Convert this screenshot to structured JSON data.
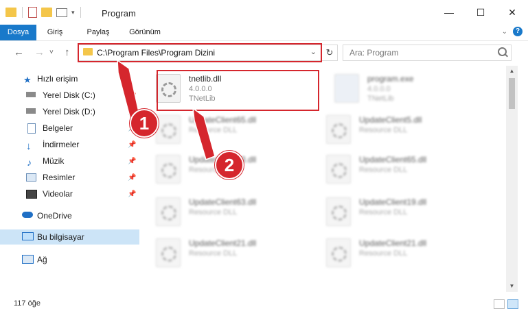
{
  "window": {
    "title": "Program",
    "controls": [
      "—",
      "☐",
      "✕"
    ]
  },
  "ribbon": {
    "tabs": [
      "Dosya",
      "Giriş",
      "Paylaş",
      "Görünüm"
    ],
    "help": "?"
  },
  "nav": {
    "address": "C:\\Program Files\\Program Dizini",
    "search_placeholder": "Ara: Program"
  },
  "sidebar": {
    "items": [
      {
        "label": "Hızlı erişim",
        "icon": "star-icon"
      },
      {
        "label": "Yerel Disk (C:)",
        "icon": "drive-icon"
      },
      {
        "label": "Yerel Disk (D:)",
        "icon": "drive-icon"
      },
      {
        "label": "Belgeler",
        "icon": "documents-icon"
      },
      {
        "label": "İndirmeler",
        "icon": "download-icon"
      },
      {
        "label": "Müzik",
        "icon": "music-icon"
      },
      {
        "label": "Resimler",
        "icon": "pictures-icon"
      },
      {
        "label": "Videolar",
        "icon": "video-icon"
      },
      {
        "label": "OneDrive",
        "icon": "cloud-icon"
      },
      {
        "label": "Bu bilgisayar",
        "icon": "computer-icon"
      },
      {
        "label": "Ağ",
        "icon": "network-icon"
      }
    ]
  },
  "files": [
    {
      "name": "tnetlib.dll",
      "line1": "4.0.0.0",
      "line2": "TNetLib"
    },
    {
      "name": "program.exe",
      "line1": "4.0.0.0",
      "line2": "TNetLib"
    },
    {
      "name": "UpdateClient65.dll",
      "line1": "Resource DLL"
    },
    {
      "name": "UpdateClient5.dll",
      "line1": "Resource DLL"
    },
    {
      "name": "UpdateClient63.dll",
      "line1": "Resource DLL"
    },
    {
      "name": "UpdateClient65.dll",
      "line1": "Resource DLL"
    },
    {
      "name": "UpdateClient63.dll",
      "line1": "Resource DLL"
    },
    {
      "name": "UpdateClient19.dll",
      "line1": "Resource DLL"
    },
    {
      "name": "UpdateClient21.dll",
      "line1": "Resource DLL"
    },
    {
      "name": "UpdateClient21.dll",
      "line1": "Resource DLL"
    }
  ],
  "status": {
    "count": "117 öğe"
  },
  "annotations": {
    "badge1": "1",
    "badge2": "2",
    "color": "#d5262d"
  }
}
